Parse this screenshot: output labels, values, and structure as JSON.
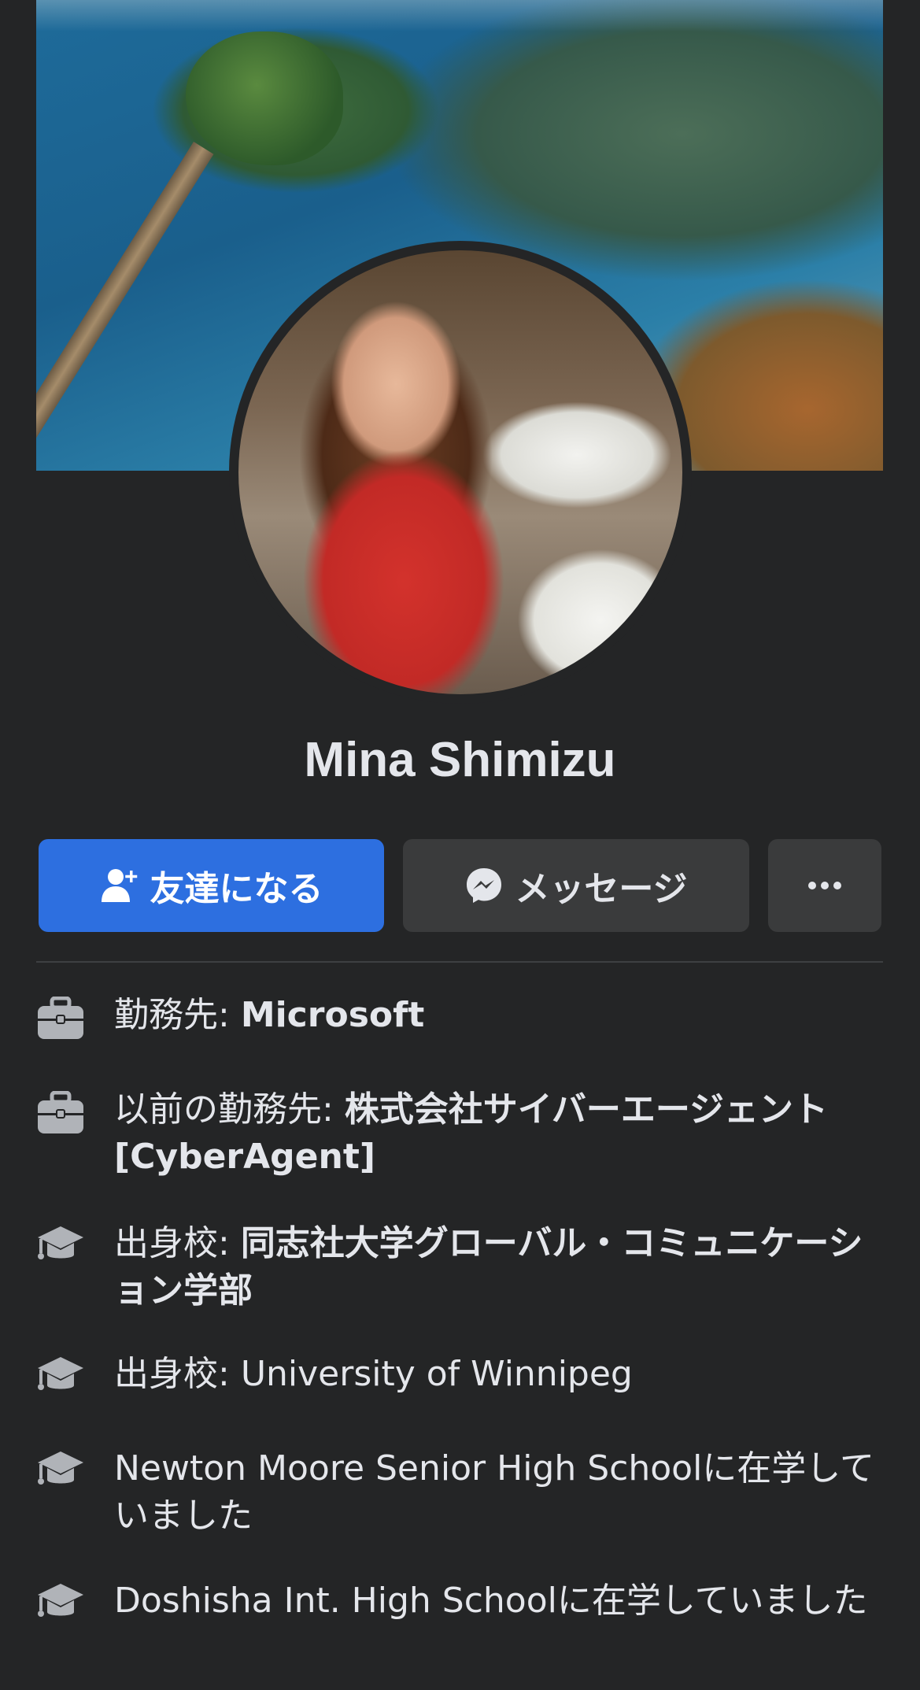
{
  "profile": {
    "name": "Mina Shimizu"
  },
  "actions": {
    "add_friend_label": "友達になる",
    "message_label": "メッセージ",
    "more_label": "···"
  },
  "intro": {
    "work_current": {
      "prefix": "勤務先: ",
      "value": "Microsoft",
      "icon": "briefcase-icon"
    },
    "work_previous": {
      "prefix": "以前の勤務先: ",
      "value": "株式会社サイバーエージェント [CyberAgent]",
      "icon": "briefcase-icon"
    },
    "education_1": {
      "prefix": "出身校: ",
      "value": "同志社大学グローバル・コミュニケーション学部",
      "icon": "graduation-cap-icon"
    },
    "education_2": {
      "prefix": "出身校: ",
      "value": "University of Winnipeg",
      "icon": "graduation-cap-icon"
    },
    "education_3": {
      "school": "Newton Moore Senior High School",
      "suffix": "に在学していました",
      "icon": "graduation-cap-icon"
    },
    "education_4": {
      "school": "Doshisha Int. High School",
      "suffix": "に在学していました",
      "icon": "graduation-cap-icon"
    }
  },
  "colors": {
    "background": "#242526",
    "primary_button": "#2d6fe0",
    "secondary_button": "#3a3b3c",
    "text": "#e4e6eb",
    "icon": "#b0b3b8"
  }
}
